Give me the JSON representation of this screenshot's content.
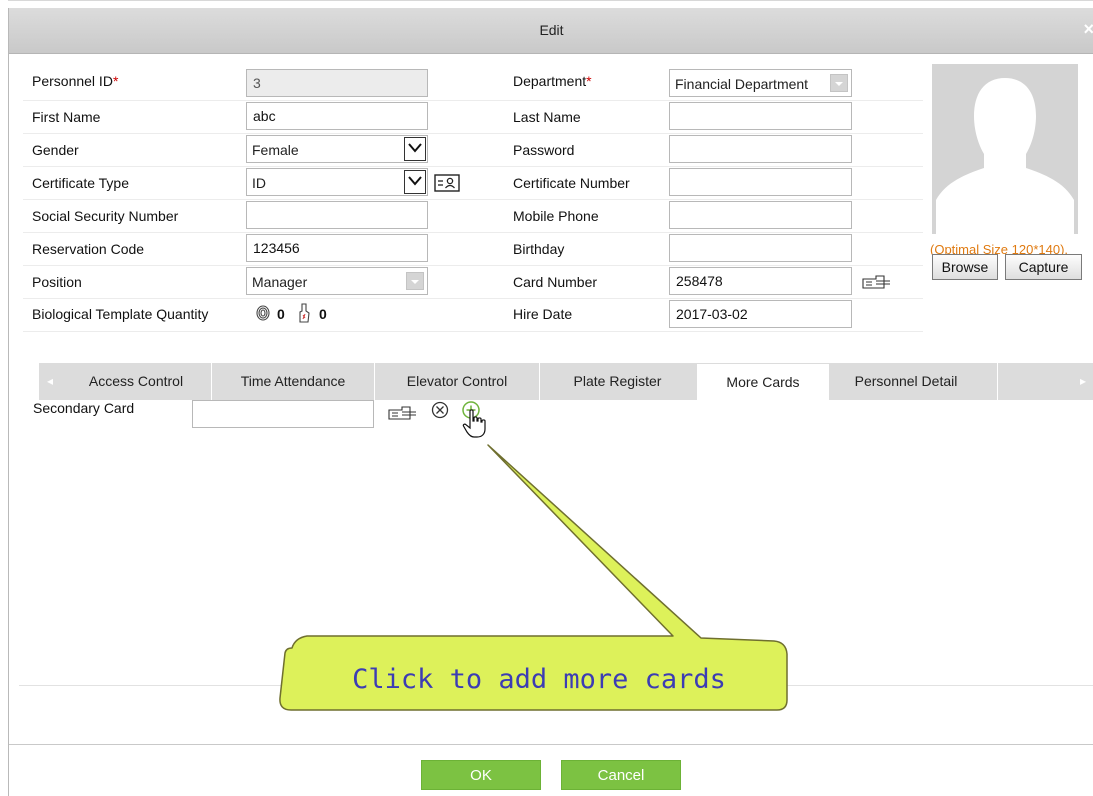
{
  "dialog": {
    "title": "Edit",
    "close_glyph": "×"
  },
  "form": {
    "left": [
      {
        "label": "Personnel ID",
        "required": true,
        "type": "input",
        "value": "3",
        "disabled": true
      },
      {
        "label": "First Name",
        "required": false,
        "type": "input",
        "value": "abc"
      },
      {
        "label": "Gender",
        "required": false,
        "type": "select",
        "value": "Female"
      },
      {
        "label": "Certificate Type",
        "required": false,
        "type": "select",
        "value": "ID"
      },
      {
        "label": "Social Security Number",
        "required": false,
        "type": "input",
        "value": ""
      },
      {
        "label": "Reservation Code",
        "required": false,
        "type": "input",
        "value": "123456"
      },
      {
        "label": "Position",
        "required": false,
        "type": "combo",
        "value": "Manager"
      },
      {
        "label": "Biological Template Quantity",
        "required": false,
        "type": "bio",
        "fingerprint_count": "0",
        "finger_vein_count": "0"
      }
    ],
    "right": [
      {
        "label": "Department",
        "required": true,
        "type": "combo",
        "value": "Financial Department"
      },
      {
        "label": "Last Name",
        "required": false,
        "type": "input",
        "value": ""
      },
      {
        "label": "Password",
        "required": false,
        "type": "input",
        "value": ""
      },
      {
        "label": "Certificate Number",
        "required": false,
        "type": "input",
        "value": ""
      },
      {
        "label": "Mobile Phone",
        "required": false,
        "type": "input",
        "value": ""
      },
      {
        "label": "Birthday",
        "required": false,
        "type": "input",
        "value": ""
      },
      {
        "label": "Card Number",
        "required": false,
        "type": "input",
        "value": "258478"
      },
      {
        "label": "Hire Date",
        "required": false,
        "type": "input",
        "value": "2017-03-02"
      }
    ],
    "required_mark": "*"
  },
  "photo": {
    "caption": "(Optimal Size 120*140).",
    "browse_label": "Browse",
    "capture_label": "Capture"
  },
  "tabs": [
    {
      "label": "Access Control",
      "active": false
    },
    {
      "label": "Time Attendance",
      "active": false
    },
    {
      "label": "Elevator Control",
      "active": false
    },
    {
      "label": "Plate Register",
      "active": false
    },
    {
      "label": "More Cards",
      "active": true
    },
    {
      "label": "Personnel Detail",
      "active": false
    }
  ],
  "more_cards": {
    "secondary_card_label": "Secondary Card",
    "secondary_card_value": ""
  },
  "callout": {
    "text": "Click to add more cards",
    "fill": "#ddf15a",
    "border": "#6f6f2f"
  },
  "footer": {
    "ok_label": "OK",
    "cancel_label": "Cancel"
  },
  "colors": {
    "green_button": "#7cc242",
    "title_bar": "#cfcfcf",
    "tab_bar": "#dcdcdc",
    "caption_orange": "#e07a10"
  }
}
